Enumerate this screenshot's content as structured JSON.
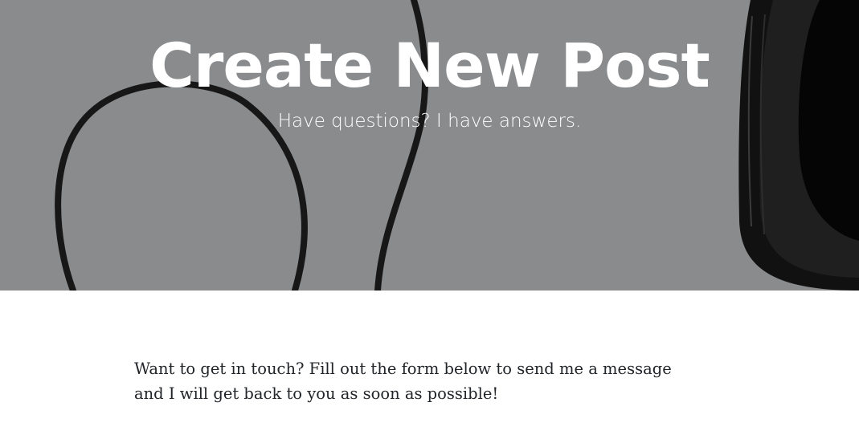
{
  "header": {
    "title": "Create New Post",
    "subtitle": "Have questions? I have answers."
  },
  "main": {
    "intro": "Want to get in touch? Fill out the form below to send me a message and I will get back to you as soon as possible!"
  },
  "colors": {
    "hero_overlay": "#8a8b8d",
    "heading_text": "#ffffff",
    "body_text": "#212529",
    "page_background": "#ffffff"
  }
}
